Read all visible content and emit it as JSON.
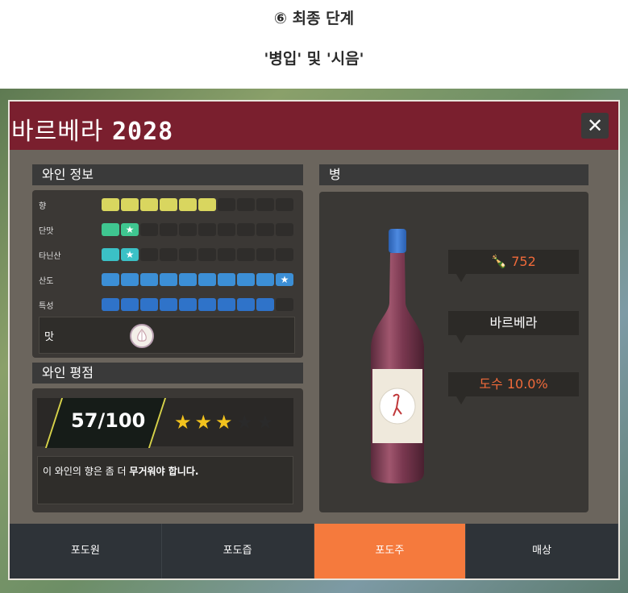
{
  "caption": {
    "line1": "⑥ 최종 단계",
    "line2": "'병입' 및 '시음'"
  },
  "window": {
    "title_name": "바르베라",
    "title_year": "2028",
    "close_label": "✕"
  },
  "wine_info": {
    "header": "와인 정보",
    "attributes": [
      {
        "label": "향",
        "filled": 6,
        "total": 10,
        "color": "#d9d65f",
        "star": false
      },
      {
        "label": "단맛",
        "filled": 2,
        "total": 10,
        "color": "#3fc690",
        "star": true
      },
      {
        "label": "타닌산",
        "filled": 2,
        "total": 10,
        "color": "#3bc1c6",
        "star": true
      },
      {
        "label": "산도",
        "filled": 10,
        "total": 10,
        "color": "#3c8fd6",
        "star": true
      },
      {
        "label": "특성",
        "filled": 9,
        "total": 10,
        "color": "#2f73c9",
        "star": false
      }
    ],
    "taste_label": "맛",
    "taste_icon": "garlic-icon"
  },
  "rating": {
    "header": "와인 평점",
    "score": "57/100",
    "stars_filled": 3,
    "stars_total": 5,
    "comment_prefix": "이 와인의 향은 좀 더 ",
    "comment_bold": "무거워야 합니다."
  },
  "bottle": {
    "header": "병",
    "count_icon": "bottles-icon",
    "count": "752",
    "variety": "바르베라",
    "abv": "도수 10.0%"
  },
  "tabs": [
    {
      "label": "포도원",
      "active": false
    },
    {
      "label": "포도즙",
      "active": false
    },
    {
      "label": "포도주",
      "active": true
    },
    {
      "label": "매상",
      "active": false
    }
  ]
}
